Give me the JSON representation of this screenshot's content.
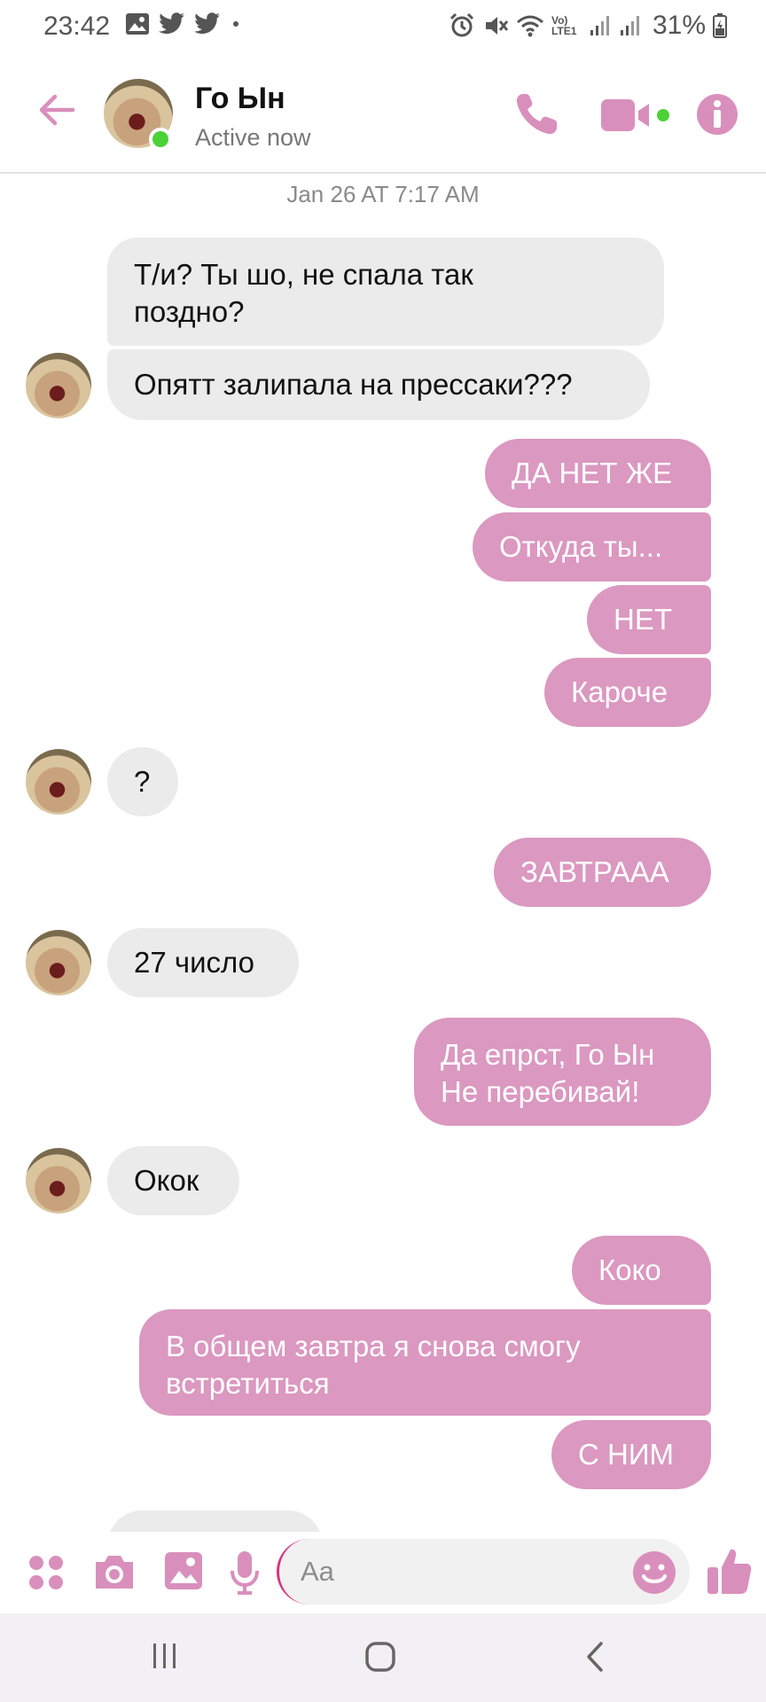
{
  "status_bar": {
    "time": "23:42",
    "battery_percent": "31%",
    "left_icons": [
      "gallery-icon",
      "twitter-icon",
      "twitter-icon",
      "dot-icon"
    ],
    "right_icons": [
      "alarm-icon",
      "mute-icon",
      "wifi-icon",
      "volte-icon",
      "signal-icon",
      "signal-icon",
      "battery-icon"
    ],
    "network_label": "Vo) LTE1"
  },
  "header": {
    "contact_name": "Го Ын",
    "contact_status": "Active now"
  },
  "conversation": {
    "timestamp": "Jan 26 AT 7:17 AM",
    "messages": [
      {
        "from": "them",
        "text": "Т/и? Ты шо, не спала так поздно?"
      },
      {
        "from": "them",
        "text": "Опятт залипала на прессаки???"
      },
      {
        "from": "me",
        "text": "ДА НЕТ ЖЕ"
      },
      {
        "from": "me",
        "text": "Откуда ты..."
      },
      {
        "from": "me",
        "text": "НЕТ"
      },
      {
        "from": "me",
        "text": "Кароче"
      },
      {
        "from": "them",
        "text": "?"
      },
      {
        "from": "me",
        "text": "ЗАВТРААА"
      },
      {
        "from": "them",
        "text": "27 число"
      },
      {
        "from": "me",
        "text": "Да епрст, Го Ын Не перебивай!"
      },
      {
        "from": "them",
        "text": "Окок"
      },
      {
        "from": "me",
        "text": "Коко"
      },
      {
        "from": "me",
        "text": "В общем завтра я снова смогу встретиться"
      },
      {
        "from": "me",
        "text": "С НИМ"
      }
    ],
    "lines": {
      "m0_l1": "Т/и? Ты шо, не спала так",
      "m0_l2": "поздно?",
      "m9_l1": "Да епрст, Го Ын",
      "m9_l2": "Не перебивай!",
      "m12_l1": "В общем завтра я снова смогу",
      "m12_l2": "встретиться"
    }
  },
  "composer": {
    "placeholder": "Aa",
    "icons": [
      "apps-icon",
      "camera-icon",
      "image-icon",
      "microphone-icon",
      "emoji-icon",
      "thumbs-up-icon"
    ]
  },
  "navbar": {
    "icons": [
      "recent-apps-icon",
      "home-icon",
      "back-icon"
    ]
  },
  "colors": {
    "accent": "#d98fbc",
    "outgoing_bubble": "#db98c0",
    "incoming_bubble": "#ebebeb",
    "online": "#4cd137"
  }
}
